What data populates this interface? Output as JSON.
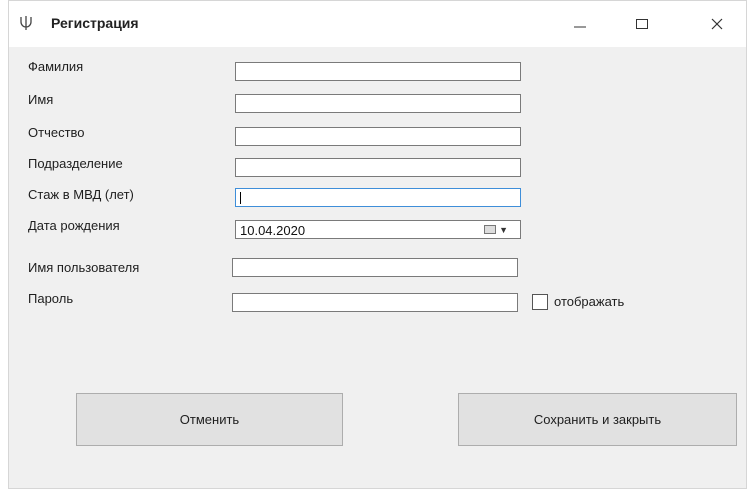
{
  "window": {
    "title": "Регистрация",
    "app_icon": "psi-icon"
  },
  "form": {
    "surname_label": "Фамилия",
    "surname_value": "",
    "name_label": "Имя",
    "name_value": "",
    "patronymic_label": "Отчество",
    "patronymic_value": "",
    "department_label": "Подразделение",
    "department_value": "",
    "experience_label": "Стаж в МВД (лет)",
    "experience_value": "",
    "birthdate_label": "Дата рождения",
    "birthdate_value": "10.04.2020",
    "username_label": "Имя пользователя",
    "username_value": "",
    "password_label": "Пароль",
    "password_value": "",
    "show_password_label": "отображать",
    "show_password_checked": false
  },
  "buttons": {
    "cancel_label": "Отменить",
    "save_label": "Сохранить и закрыть"
  }
}
